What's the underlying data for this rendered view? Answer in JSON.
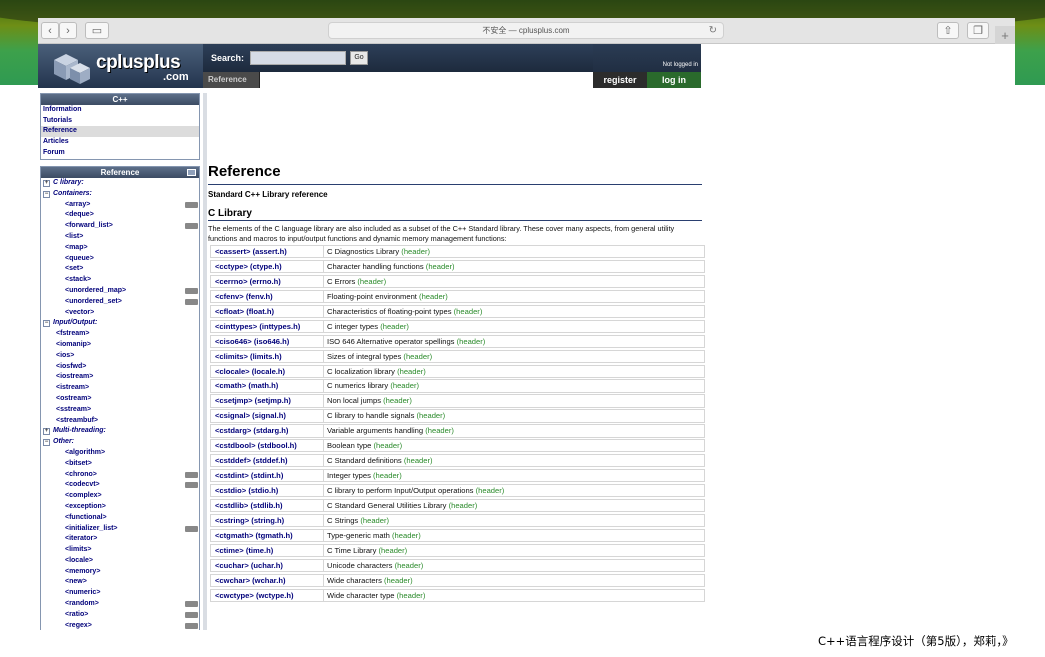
{
  "browser": {
    "address": "不安全 — cplusplus.com",
    "new_tab": "+"
  },
  "header": {
    "logo_text": "cplusplus",
    "logo_com": ".com",
    "search_label": "Search:",
    "search_value": "",
    "search_go": "Go",
    "ref_tab": "Reference",
    "not_logged_in": "Not logged in",
    "register": "register",
    "login": "log in"
  },
  "sidebar": {
    "cpp_head": "C++",
    "cpp_links": [
      "Information",
      "Tutorials",
      "Reference",
      "Articles",
      "Forum"
    ],
    "ref_head": "Reference",
    "tree": [
      {
        "label": "C library:",
        "kind": "cat",
        "toggle": "+"
      },
      {
        "label": "Containers:",
        "kind": "cat",
        "toggle": "−"
      },
      {
        "label": "<array>",
        "kind": "item",
        "ver": true
      },
      {
        "label": "<deque>",
        "kind": "item"
      },
      {
        "label": "<forward_list>",
        "kind": "item",
        "ver": true
      },
      {
        "label": "<list>",
        "kind": "item"
      },
      {
        "label": "<map>",
        "kind": "item"
      },
      {
        "label": "<queue>",
        "kind": "item"
      },
      {
        "label": "<set>",
        "kind": "item"
      },
      {
        "label": "<stack>",
        "kind": "item"
      },
      {
        "label": "<unordered_map>",
        "kind": "item",
        "ver": true
      },
      {
        "label": "<unordered_set>",
        "kind": "item",
        "ver": true
      },
      {
        "label": "<vector>",
        "kind": "item"
      },
      {
        "label": "Input/Output:",
        "kind": "cat",
        "toggle": "−"
      },
      {
        "label": "<fstream>",
        "kind": "io"
      },
      {
        "label": "<iomanip>",
        "kind": "io"
      },
      {
        "label": "<ios>",
        "kind": "io"
      },
      {
        "label": "<iosfwd>",
        "kind": "io"
      },
      {
        "label": "<iostream>",
        "kind": "io"
      },
      {
        "label": "<istream>",
        "kind": "io"
      },
      {
        "label": "<ostream>",
        "kind": "io"
      },
      {
        "label": "<sstream>",
        "kind": "io"
      },
      {
        "label": "<streambuf>",
        "kind": "io"
      },
      {
        "label": "Multi-threading:",
        "kind": "cat",
        "toggle": "+"
      },
      {
        "label": "Other:",
        "kind": "cat",
        "toggle": "−"
      },
      {
        "label": "<algorithm>",
        "kind": "item"
      },
      {
        "label": "<bitset>",
        "kind": "item"
      },
      {
        "label": "<chrono>",
        "kind": "item",
        "ver": true
      },
      {
        "label": "<codecvt>",
        "kind": "item",
        "ver": true
      },
      {
        "label": "<complex>",
        "kind": "item"
      },
      {
        "label": "<exception>",
        "kind": "item"
      },
      {
        "label": "<functional>",
        "kind": "item"
      },
      {
        "label": "<initializer_list>",
        "kind": "item",
        "ver": true
      },
      {
        "label": "<iterator>",
        "kind": "item"
      },
      {
        "label": "<limits>",
        "kind": "item"
      },
      {
        "label": "<locale>",
        "kind": "item"
      },
      {
        "label": "<memory>",
        "kind": "item"
      },
      {
        "label": "<new>",
        "kind": "item"
      },
      {
        "label": "<numeric>",
        "kind": "item"
      },
      {
        "label": "<random>",
        "kind": "item",
        "ver": true
      },
      {
        "label": "<ratio>",
        "kind": "item",
        "ver": true
      },
      {
        "label": "<regex>",
        "kind": "item",
        "ver": true
      }
    ]
  },
  "main": {
    "title": "Reference",
    "subtitle": "Standard C++ Library reference",
    "section": "C Library",
    "intro": "The elements of the C language library are also included as a subset of the C++ Standard library. These cover many aspects, from general utility functions and macros to input/output functions and dynamic memory management functions:",
    "header_tag": "(header)",
    "libraries": [
      {
        "name": "<cassert> (assert.h)",
        "desc": "C Diagnostics Library"
      },
      {
        "name": "<cctype> (ctype.h)",
        "desc": "Character handling functions"
      },
      {
        "name": "<cerrno> (errno.h)",
        "desc": "C Errors"
      },
      {
        "name": "<cfenv> (fenv.h)",
        "desc": "Floating-point environment"
      },
      {
        "name": "<cfloat> (float.h)",
        "desc": "Characteristics of floating-point types"
      },
      {
        "name": "<cinttypes> (inttypes.h)",
        "desc": "C integer types"
      },
      {
        "name": "<ciso646> (iso646.h)",
        "desc": "ISO 646 Alternative operator spellings"
      },
      {
        "name": "<climits> (limits.h)",
        "desc": "Sizes of integral types"
      },
      {
        "name": "<clocale> (locale.h)",
        "desc": "C localization library"
      },
      {
        "name": "<cmath> (math.h)",
        "desc": "C numerics library"
      },
      {
        "name": "<csetjmp> (setjmp.h)",
        "desc": "Non local jumps"
      },
      {
        "name": "<csignal> (signal.h)",
        "desc": "C library to handle signals"
      },
      {
        "name": "<cstdarg> (stdarg.h)",
        "desc": "Variable arguments handling"
      },
      {
        "name": "<cstdbool> (stdbool.h)",
        "desc": "Boolean type"
      },
      {
        "name": "<cstddef> (stddef.h)",
        "desc": "C Standard definitions"
      },
      {
        "name": "<cstdint> (stdint.h)",
        "desc": "Integer types"
      },
      {
        "name": "<cstdio> (stdio.h)",
        "desc": "C library to perform Input/Output operations"
      },
      {
        "name": "<cstdlib> (stdlib.h)",
        "desc": "C Standard General Utilities Library"
      },
      {
        "name": "<cstring> (string.h)",
        "desc": "C Strings"
      },
      {
        "name": "<ctgmath> (tgmath.h)",
        "desc": "Type-generic math"
      },
      {
        "name": "<ctime> (time.h)",
        "desc": "C Time Library"
      },
      {
        "name": "<cuchar> (uchar.h)",
        "desc": "Unicode characters"
      },
      {
        "name": "<cwchar> (wchar.h)",
        "desc": "Wide characters"
      },
      {
        "name": "<cwctype> (wctype.h)",
        "desc": "Wide character type"
      }
    ]
  },
  "caption": "C++语言程序设计（第5版），郑莉，》"
}
